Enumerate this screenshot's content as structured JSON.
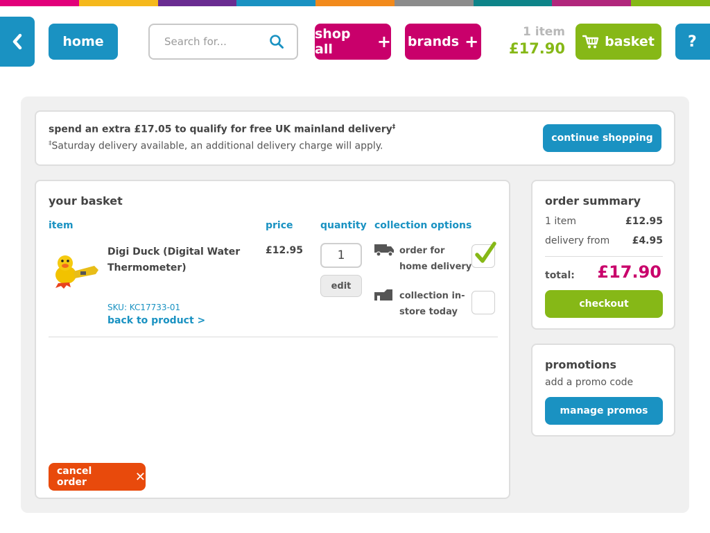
{
  "header": {
    "stripe_colors": [
      "#e2007a",
      "#f5b81c",
      "#6a2c91",
      "#1a92c2",
      "#f28a1c",
      "#8c8c8c",
      "#0e8489",
      "#b1277c",
      "#86b817"
    ],
    "home_label": "home",
    "search_placeholder": "Search for...",
    "shop_all_label": "shop all",
    "brands_label": "brands",
    "plus_glyph": "+",
    "mini_basket_count": "1 item",
    "mini_basket_total": "£17.90",
    "basket_label": "basket",
    "help_label": "?"
  },
  "notice": {
    "line1": "spend an extra £17.05 to qualify for free UK mainland delivery",
    "line1_mark": "‡",
    "line2_mark": "‡",
    "line2": "Saturday delivery available, an additional delivery charge will apply.",
    "continue_label": "continue shopping"
  },
  "basket": {
    "title": "your basket",
    "columns": {
      "item": "item",
      "price": "price",
      "quantity": "quantity",
      "collection": "collection options"
    },
    "items": [
      {
        "name": "Digi Duck (Digital Water Thermometer)",
        "sku": "SKU: KC17733-01",
        "back_link": "back to product >",
        "price": "£12.95",
        "quantity": "1",
        "edit_label": "edit",
        "options": [
          {
            "label": "order for home delivery",
            "icon": "truck-icon",
            "selected": true
          },
          {
            "label": "collection in-store today",
            "icon": "shop-icon",
            "selected": false
          }
        ]
      }
    ],
    "cancel_label": "cancel order",
    "cancel_glyph": "✕"
  },
  "summary": {
    "title": "order summary",
    "items_label": "1 item",
    "items_value": "£12.95",
    "delivery_label": "delivery from",
    "delivery_value": "£4.95",
    "total_label": "total:",
    "total_value": "£17.90",
    "checkout_label": "checkout"
  },
  "promotions": {
    "title": "promotions",
    "subtitle": "add a promo code",
    "button_label": "manage promos"
  },
  "colors": {
    "blue": "#1a92c2",
    "magenta": "#c9006b",
    "green": "#86b817",
    "orange": "#e84a0c"
  }
}
